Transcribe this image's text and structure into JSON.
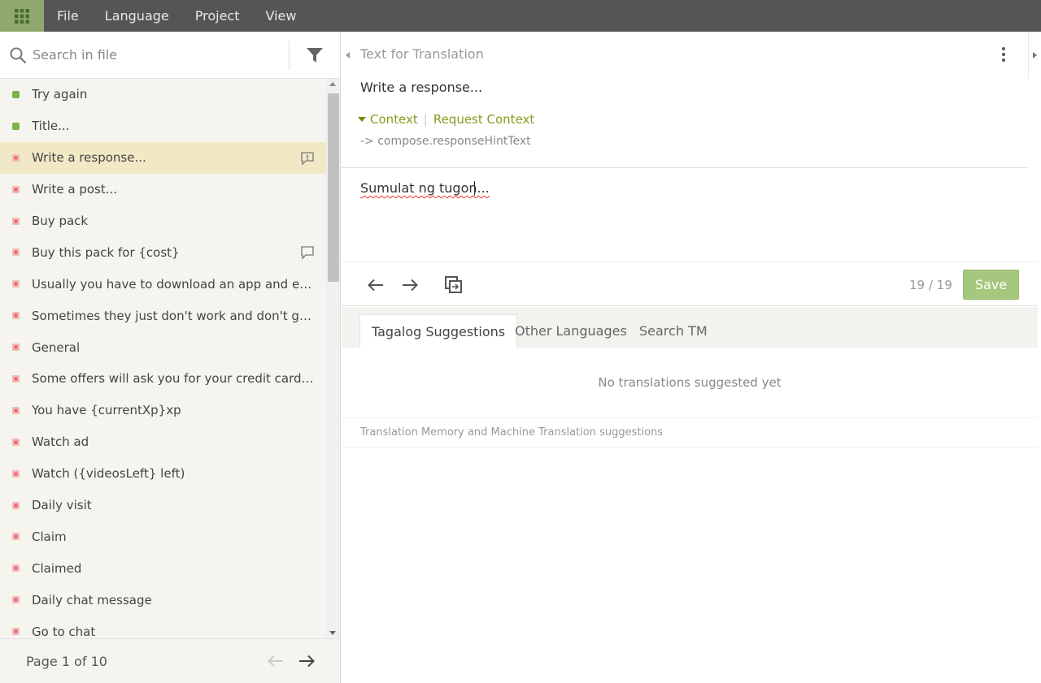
{
  "menu": {
    "items": [
      "File",
      "Language",
      "Project",
      "View"
    ]
  },
  "sidebar": {
    "search_placeholder": "Search in file",
    "items": [
      {
        "label": "Try again",
        "status": "translated"
      },
      {
        "label": "Title...",
        "status": "translated"
      },
      {
        "label": "Write a response...",
        "status": "untranslated",
        "active": true,
        "icon": "issue-icon"
      },
      {
        "label": "Write a post...",
        "status": "untranslated"
      },
      {
        "label": "Buy pack",
        "status": "untranslated"
      },
      {
        "label": "Buy this pack for {cost}",
        "status": "untranslated",
        "icon": "comment-icon"
      },
      {
        "label": "Usually you have to download an app and either s...",
        "status": "untranslated"
      },
      {
        "label": "Sometimes they just don't work and don't give yo...",
        "status": "untranslated"
      },
      {
        "label": "General",
        "status": "untranslated"
      },
      {
        "label": "Some offers will ask you for your credit card infor...",
        "status": "untranslated"
      },
      {
        "label": "You have {currentXp}xp",
        "status": "untranslated"
      },
      {
        "label": "Watch ad",
        "status": "untranslated"
      },
      {
        "label": "Watch ({videosLeft} left)",
        "status": "untranslated"
      },
      {
        "label": "Daily visit",
        "status": "untranslated"
      },
      {
        "label": "Claim",
        "status": "untranslated"
      },
      {
        "label": "Claimed",
        "status": "untranslated"
      },
      {
        "label": "Daily chat message",
        "status": "untranslated"
      },
      {
        "label": "Go to chat",
        "status": "untranslated"
      }
    ],
    "page_label": "Page 1 of 10"
  },
  "source": {
    "header": "Text for Translation",
    "text": "Write a response...",
    "context_label": "Context",
    "request_context_label": "Request Context",
    "context_key": "-> compose.responseHintText"
  },
  "editor": {
    "translation": "Sumulat ng tugon..."
  },
  "toolbar": {
    "counter": "19 / 19",
    "save_label": "Save"
  },
  "tabs": [
    "Tagalog Suggestions",
    "Other Languages",
    "Search TM"
  ],
  "suggestions": {
    "empty_text": "No translations suggested yet",
    "note": "Translation Memory and Machine Translation suggestions"
  },
  "colors": {
    "topbar": "#555555",
    "accent_green": "#8fa86e",
    "save_green": "#a6c77e",
    "active_row": "#f1e8c6",
    "context_olive": "#8a9a1c"
  }
}
